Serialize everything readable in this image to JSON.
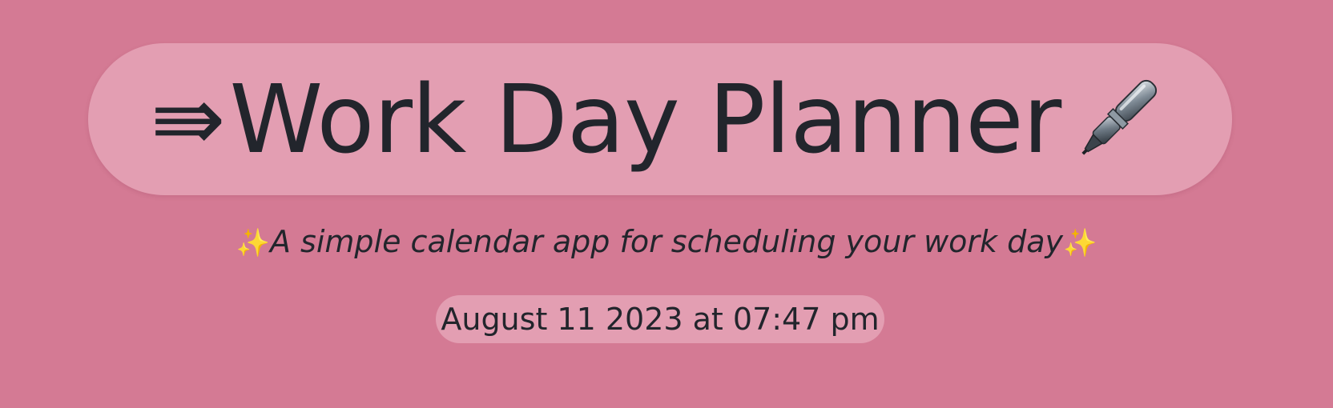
{
  "header": {
    "arrow_glyph": "⇛",
    "title": "Work Day Planner",
    "title_icon": "pen-icon",
    "subtitle": "A simple calendar app for scheduling your work day",
    "subtitle_icon": "sparkles-icon",
    "sparkle_glyph": "✨",
    "current_datetime": "August 11 2023 at 07:47 pm"
  },
  "colors": {
    "background": "#d47a94",
    "pill": "#e7a9bb",
    "text": "#22252c",
    "sparkle": "#f5c542"
  }
}
